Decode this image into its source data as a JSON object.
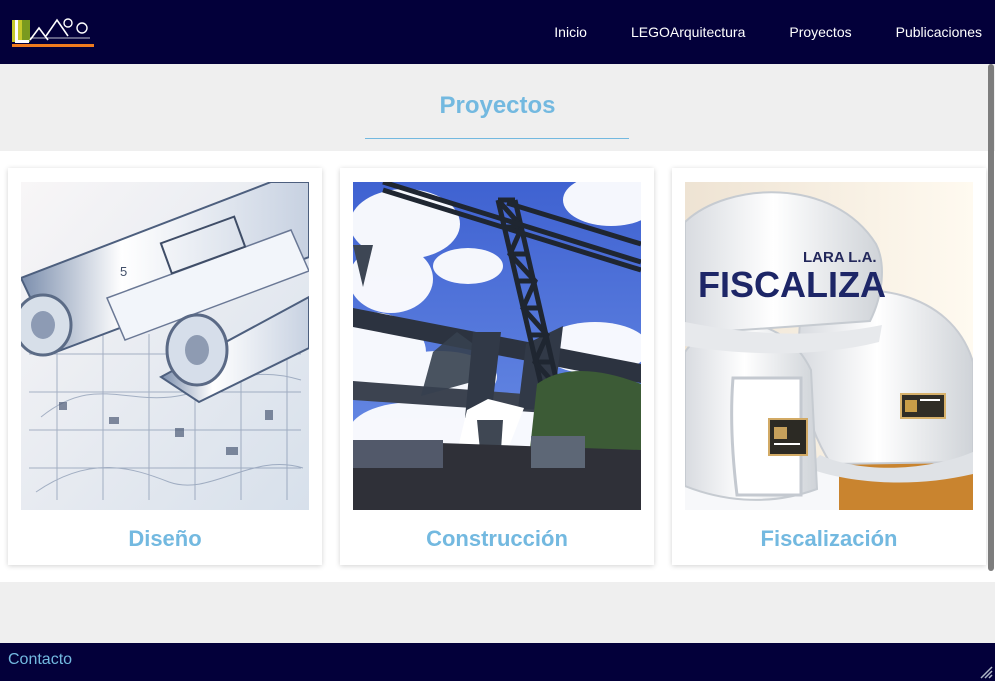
{
  "header": {
    "logo_icon": "lego-logo",
    "nav": [
      {
        "label": "Inicio"
      },
      {
        "label": "LEGOArquitectura"
      },
      {
        "label": "Proyectos"
      },
      {
        "label": "Publicaciones"
      }
    ]
  },
  "page": {
    "title": "Proyectos"
  },
  "cards": [
    {
      "title": "Diseño",
      "image_icon": "blueprint-image"
    },
    {
      "title": "Construcción",
      "image_icon": "construction-crane-image"
    },
    {
      "title": "Fiscalización",
      "image_icon": "inspection-helmets-image",
      "helmet_text_1": "LARA L.A.",
      "helmet_text_2": "FISCALIZA"
    }
  ],
  "footer": {
    "contact_label": "Contacto"
  },
  "colors": {
    "header": "#03003a",
    "accent": "#73b9e0",
    "background": "#efefef",
    "card_background": "#ffffff"
  }
}
